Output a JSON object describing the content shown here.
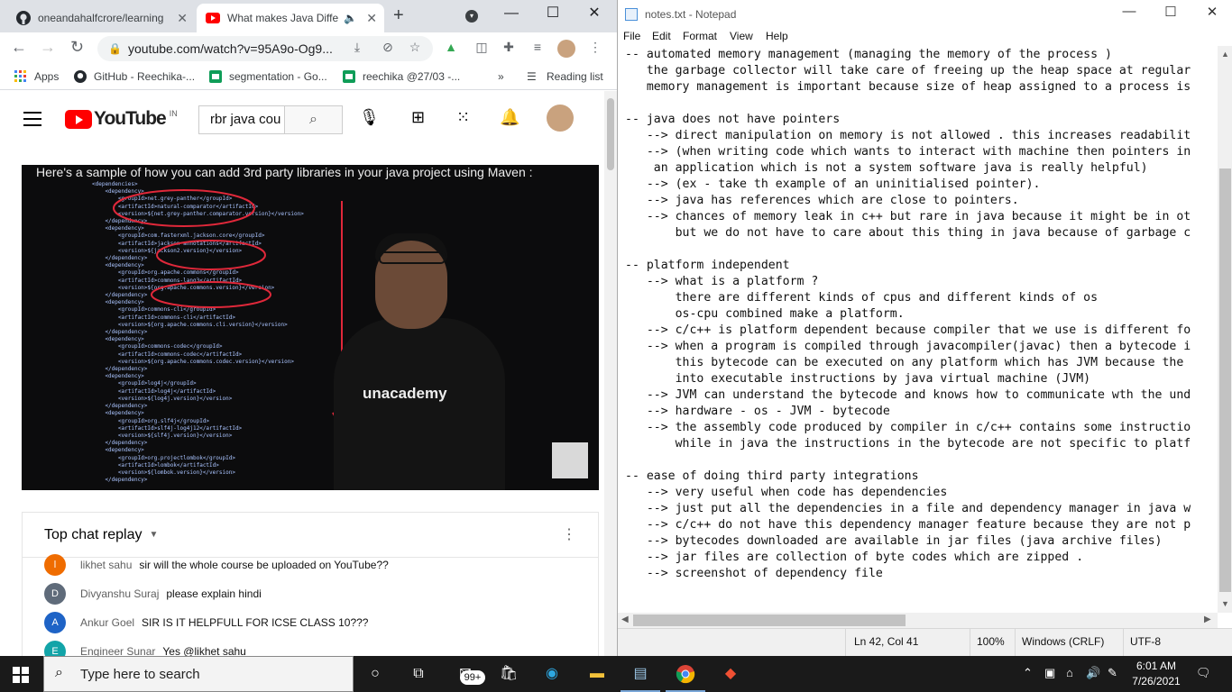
{
  "chrome": {
    "tabs": [
      {
        "title": "oneandahalfcrore/learning",
        "icon": "github-icon"
      },
      {
        "title": "What makes Java Diffe",
        "icon": "youtube-icon",
        "active": true
      }
    ],
    "new_tab": "+",
    "url": "youtube.com/watch?v=95A9o-Og9...",
    "bookmarks": [
      {
        "label": "Apps",
        "icon": "apps-grid-icon"
      },
      {
        "label": "GitHub - Reechika-...",
        "icon": "github-icon"
      },
      {
        "label": "segmentation - Go...",
        "icon": "google-sheets-icon"
      },
      {
        "label": "reechika @27/03 -...",
        "icon": "google-sheets-icon"
      },
      {
        "label": "»",
        "icon": "overflow-icon"
      },
      {
        "label": "Reading list",
        "icon": "reading-list-icon"
      }
    ]
  },
  "youtube": {
    "logo_text": "YouTube",
    "country_code": "IN",
    "search_value": "rbr java cou",
    "video": {
      "caption": "Here's a sample of how you can add 3rd party libraries in your java project using Maven :",
      "code": "<dependencies>\n    <dependency>\n        <groupId>net.grey-panther</groupId>\n        <artifactId>natural-comparator</artifactId>\n        <version>${net.grey-panther.comparator.version}</version>\n    </dependency>\n    <dependency>\n        <groupId>com.fasterxml.jackson.core</groupId>\n        <artifactId>jackson-annotations</artifactId>\n        <version>${jackson2.version}</version>\n    </dependency>\n    <dependency>\n        <groupId>org.apache.commons</groupId>\n        <artifactId>commons-lang3</artifactId>\n        <version>${org.apache.commons.version}</version>\n    </dependency>\n    <dependency>\n        <groupId>commons-cli</groupId>\n        <artifactId>commons-cli</artifactId>\n        <version>${org.apache.commons.cli.version}</version>\n    </dependency>\n    <dependency>\n        <groupId>commons-codec</groupId>\n        <artifactId>commons-codec</artifactId>\n        <version>${org.apache.commons.codec.version}</version>\n    </dependency>\n    <dependency>\n        <groupId>log4j</groupId>\n        <artifactId>log4j</artifactId>\n        <version>${log4j.version}</version>\n    </dependency>\n    <dependency>\n        <groupId>org.slf4j</groupId>\n        <artifactId>slf4j-log4j12</artifactId>\n        <version>${slf4j.version}</version>\n    </dependency>\n    <dependency>\n        <groupId>org.projectlombok</groupId>\n        <artifactId>lombok</artifactId>\n        <version>${lombok.version}</version>\n    </dependency>",
      "brand": "unacademy"
    },
    "chat": {
      "header": "Top chat replay",
      "messages": [
        {
          "initial": "l",
          "author": "likhet sahu",
          "text": "sir will the whole course be uploaded on YouTube??",
          "color": "#ef6c00"
        },
        {
          "initial": "D",
          "author": "Divyanshu Suraj",
          "text": "please explain hindi",
          "color": "#5f6b7a"
        },
        {
          "initial": "A",
          "author": "Ankur Goel",
          "text": "SIR IS IT HELPFULL FOR ICSE CLASS 10???",
          "color": "#1e63c6"
        },
        {
          "initial": "E",
          "author": "Engineer Sunar",
          "text": "Yes @likhet sahu",
          "color": "#12a4a8"
        }
      ]
    }
  },
  "notepad": {
    "title": "notes.txt - Notepad",
    "menu": [
      "File",
      "Edit",
      "Format",
      "View",
      "Help"
    ],
    "lines": [
      "-- automated memory management (managing the memory of the process )",
      "   the garbage collector will take care of freeing up the heap space at regular",
      "   memory management is important because size of heap assigned to a process is",
      "",
      "-- java does not have pointers",
      "   --> direct manipulation on memory is not allowed . this increases readabilit",
      "   --> (when writing code which wants to interact with machine then pointers in",
      "    an application which is not a system software java is really helpful)",
      "   --> (ex - take th example of an uninitialised pointer).",
      "   --> java has references which are close to pointers.",
      "   --> chances of memory leak in c++ but rare in java because it might be in ot",
      "       but we do not have to care about this thing in java because of garbage c",
      "",
      "-- platform independent",
      "   --> what is a platform ?",
      "       there are different kinds of cpus and different kinds of os",
      "       os-cpu combined make a platform.",
      "   --> c/c++ is platform dependent because compiler that we use is different fo",
      "   --> when a program is compiled through javacompiler(javac) then a bytecode i",
      "       this bytecode can be executed on any platform which has JVM because the",
      "       into executable instructions by java virtual machine (JVM)",
      "   --> JVM can understand the bytecode and knows how to communicate wth the und",
      "   --> hardware - os - JVM - bytecode",
      "   --> the assembly code produced by compiler in c/c++ contains some instructio",
      "       while in java the instructions in the bytecode are not specific to platf",
      "",
      "-- ease of doing third party integrations",
      "   --> very useful when code has dependencies",
      "   --> just put all the dependencies in a file and dependency manager in java w",
      "   --> c/c++ do not have this dependency manager feature because they are not p",
      "   --> bytecodes downloaded are available in jar files (java archive files)",
      "   --> jar files are collection of byte codes which are zipped .",
      "   --> screenshot of dependency file"
    ],
    "status": {
      "position": "Ln 42, Col 41",
      "zoom": "100%",
      "line_ending": "Windows (CRLF)",
      "encoding": "UTF-8"
    }
  },
  "taskbar": {
    "search_placeholder": "Type here to search",
    "mail_badge": "99+",
    "time": "6:01 AM",
    "date": "7/26/2021"
  }
}
